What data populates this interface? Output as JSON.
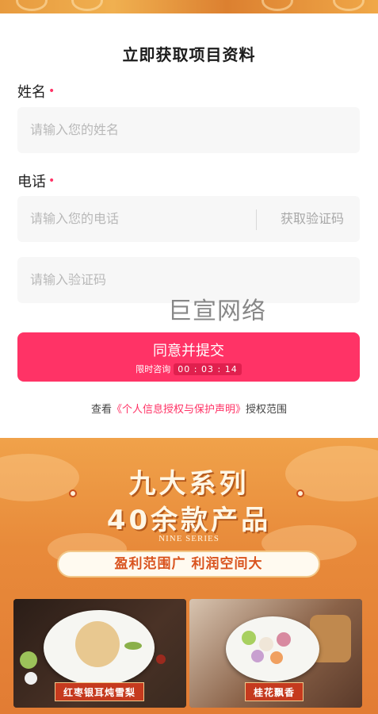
{
  "form": {
    "title": "立即获取项目资料",
    "name_label": "姓名",
    "name_placeholder": "请输入您的姓名",
    "phone_label": "电话",
    "phone_placeholder": "请输入您的电话",
    "get_code_label": "获取验证码",
    "code_placeholder": "请输入验证码",
    "required_mark": "•"
  },
  "watermark": "巨宣网络",
  "submit": {
    "label": "同意并提交",
    "countdown_label": "限时咨询",
    "countdown_value": "00 : 03 : 14"
  },
  "consent": {
    "prefix": "查看",
    "link": "《个人信息授权与保护声明》",
    "suffix": "授权范围"
  },
  "banner": {
    "title_line1": "九大系列",
    "title_line2": "40余款产品",
    "subtitle_en": "NINE SERIES",
    "pill_text": "盈利范围广 利润空间大",
    "products": [
      {
        "name": "红枣银耳炖雪梨"
      },
      {
        "name": "桂花飘香"
      }
    ]
  },
  "colors": {
    "accent": "#ff3366",
    "banner_orange": "#e88a3a"
  }
}
